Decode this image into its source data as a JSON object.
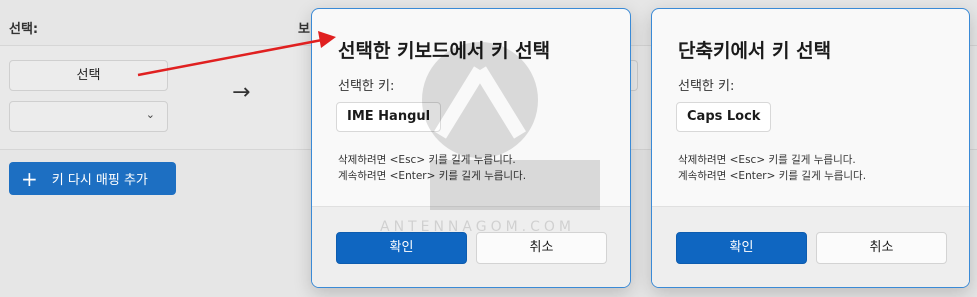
{
  "background": {
    "select_header": "선택:",
    "send_header": "보",
    "select_button": "선택",
    "arrow_glyph": "→",
    "remap_button": "키 다시 매핑 추가"
  },
  "dialog_select": {
    "title": "선택한 키보드에서 키 선택",
    "key_label": "선택한 키:",
    "key_value": "IME Hangul",
    "hint_line1": "삭제하려면 <Esc> 키를 길게 누릅니다.",
    "hint_line2": "계속하려면 <Enter> 키를 길게 누릅니다.",
    "ok_label": "확인",
    "cancel_label": "취소"
  },
  "dialog_shortcut": {
    "title": "단축키에서 키 선택",
    "key_label": "선택한 키:",
    "key_value": "Caps Lock",
    "hint_line1": "삭제하려면 <Esc> 키를 길게 누릅니다.",
    "hint_line2": "계속하려면 <Enter> 키를 길게 누릅니다.",
    "ok_label": "확인",
    "cancel_label": "취소"
  },
  "watermark": {
    "text": "ANTENNAGOM.COM"
  },
  "colors": {
    "accent": "#0f66c1",
    "annotation_red": "#e02020"
  }
}
